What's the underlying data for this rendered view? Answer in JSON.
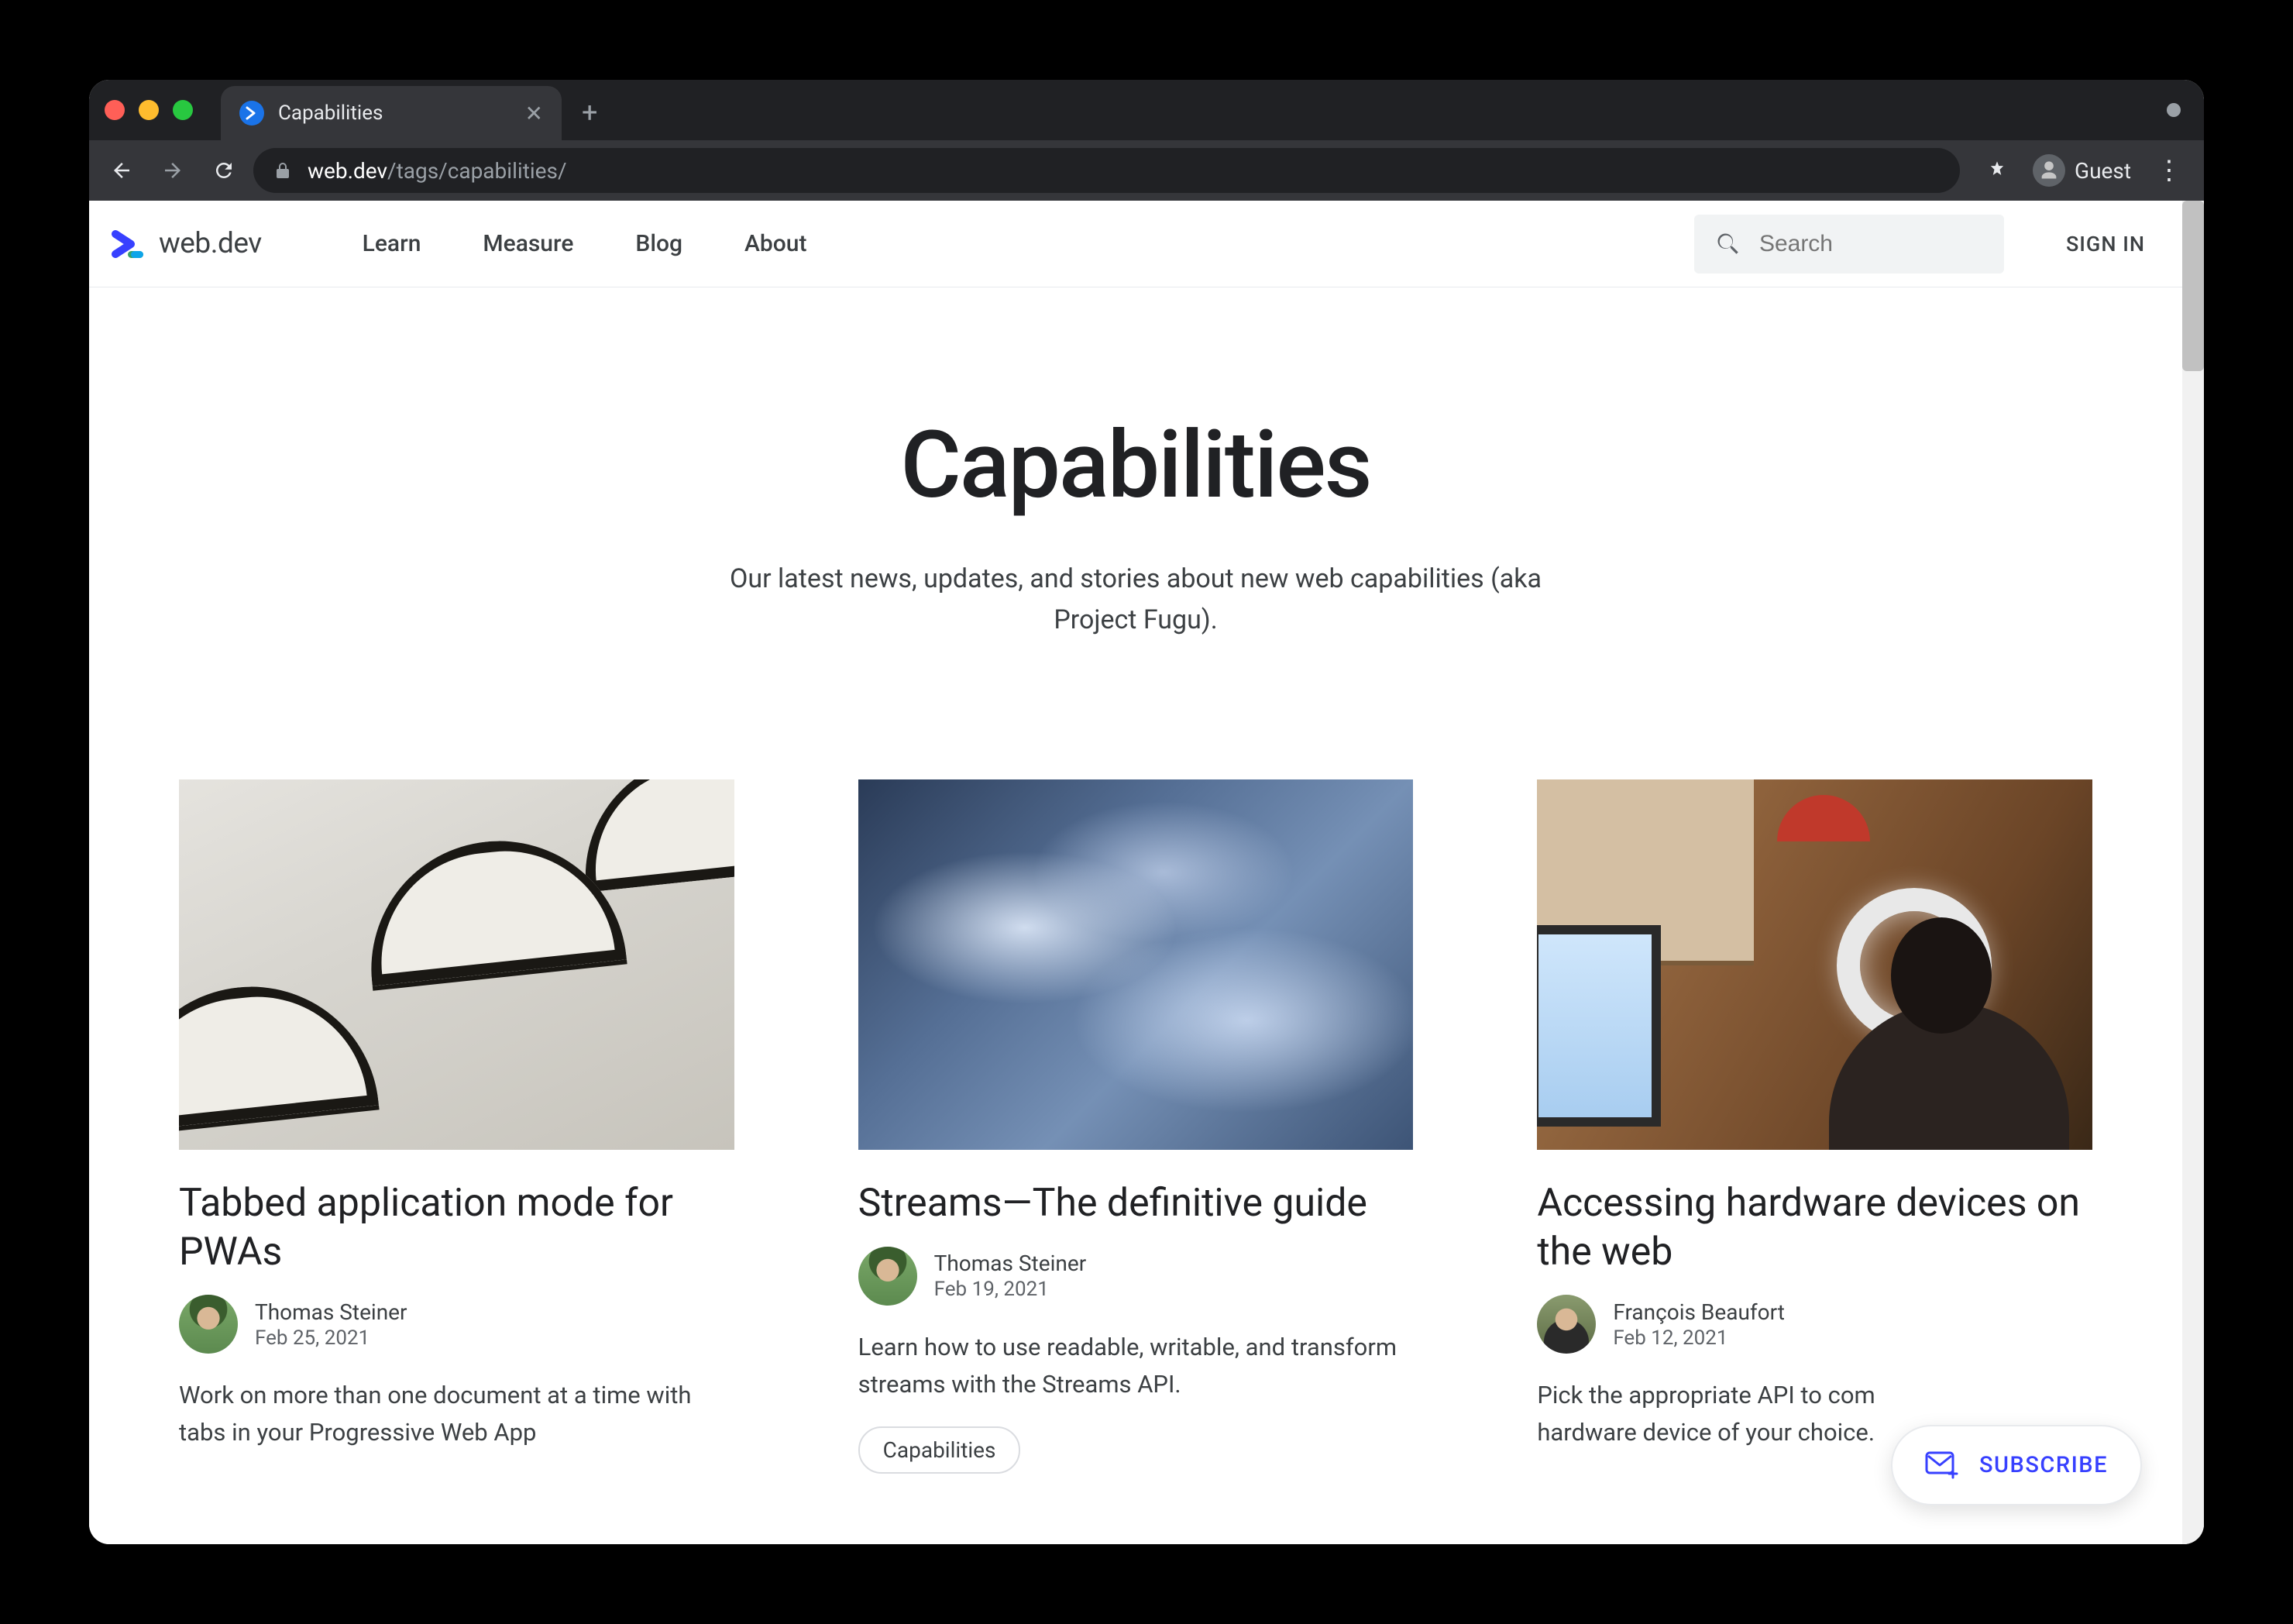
{
  "browser": {
    "tab_title": "Capabilities",
    "url_host": "web.dev",
    "url_path": "/tags/capabilities/",
    "guest_label": "Guest"
  },
  "header": {
    "logo_text": "web.dev",
    "nav": [
      "Learn",
      "Measure",
      "Blog",
      "About"
    ],
    "search_placeholder": "Search",
    "signin": "SIGN IN"
  },
  "hero": {
    "title": "Capabilities",
    "subtitle": "Our latest news, updates, and stories about new web capabilities (aka Project Fugu)."
  },
  "cards": [
    {
      "title": "Tabbed application mode for PWAs",
      "author": "Thomas Steiner",
      "date": "Feb 25, 2021",
      "desc": "Work on more than one document at a time with tabs in your Progressive Web App"
    },
    {
      "title": "Streams—The definitive guide",
      "author": "Thomas Steiner",
      "date": "Feb 19, 2021",
      "desc": "Learn how to use readable, writable, and transform streams with the Streams API.",
      "tag": "Capabilities"
    },
    {
      "title": "Accessing hardware devices on the web",
      "author": "François Beaufort",
      "date": "Feb 12, 2021",
      "desc": "Pick the appropriate API to communicate with a hardware device of your choice."
    }
  ],
  "cards_trunc": {
    "desc2": "Pick the appropriate API to com",
    "desc2b": "hardware device of your choice."
  },
  "subscribe_label": "SUBSCRIBE"
}
